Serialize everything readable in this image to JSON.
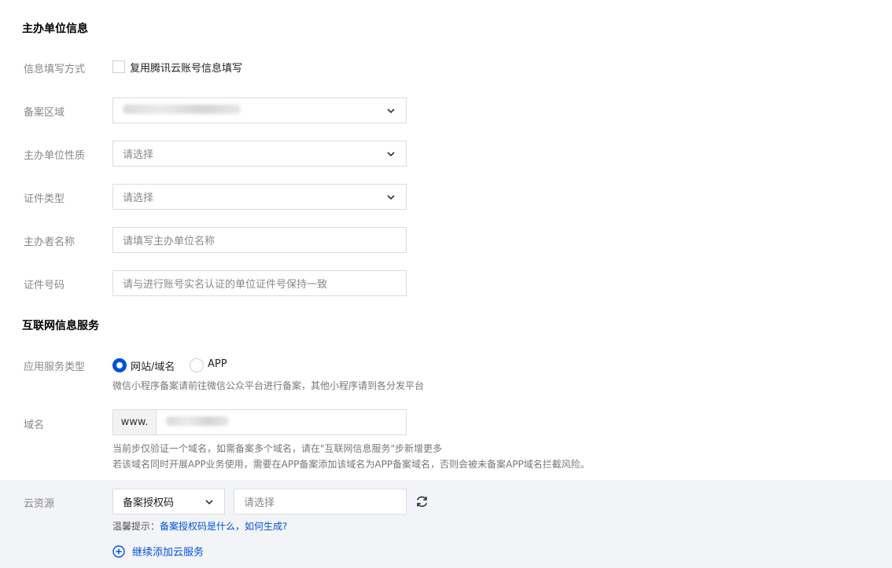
{
  "sponsor_section": {
    "title": "主办单位信息",
    "fill_mode": {
      "label": "信息填写方式",
      "checkbox_label": "复用腾讯云账号信息填写",
      "checked": false
    },
    "region": {
      "label": "备案区域"
    },
    "nature": {
      "label": "主办单位性质",
      "placeholder": "请选择"
    },
    "cert_type": {
      "label": "证件类型",
      "placeholder": "请选择"
    },
    "sponsor_name": {
      "label": "主办者名称",
      "placeholder": "请填写主办单位名称"
    },
    "cert_number": {
      "label": "证件号码",
      "placeholder": "请与进行账号实名认证的单位证件号保持一致"
    }
  },
  "internet_section": {
    "title": "互联网信息服务",
    "service_type": {
      "label": "应用服务类型",
      "options": [
        {
          "label": "网站/域名",
          "selected": true
        },
        {
          "label": "APP",
          "selected": false
        }
      ],
      "hint": "微信小程序备案请前往微信公众平台进行备案，其他小程序请到各分发平台"
    },
    "domain": {
      "label": "域名",
      "prefix": "www.",
      "hint1": "当前步仅验证一个域名，如需备案多个域名，请在\"互联网信息服务\"步新增更多",
      "hint2": "若该域名同时开展APP业务使用，需要在APP备案添加该域名为APP备案域名，否则会被未备案APP域名拦截风险。"
    },
    "cloud_resource": {
      "label": "云资源",
      "type_value": "备案授权码",
      "input_placeholder": "请选择",
      "tip_prefix": "温馨提示：",
      "tip_link": "备案授权码是什么，如何生成?",
      "add_label": "继续添加云服务"
    }
  },
  "colors": {
    "primary": "#0052d9",
    "grey_bg": "#f3f4f7"
  }
}
